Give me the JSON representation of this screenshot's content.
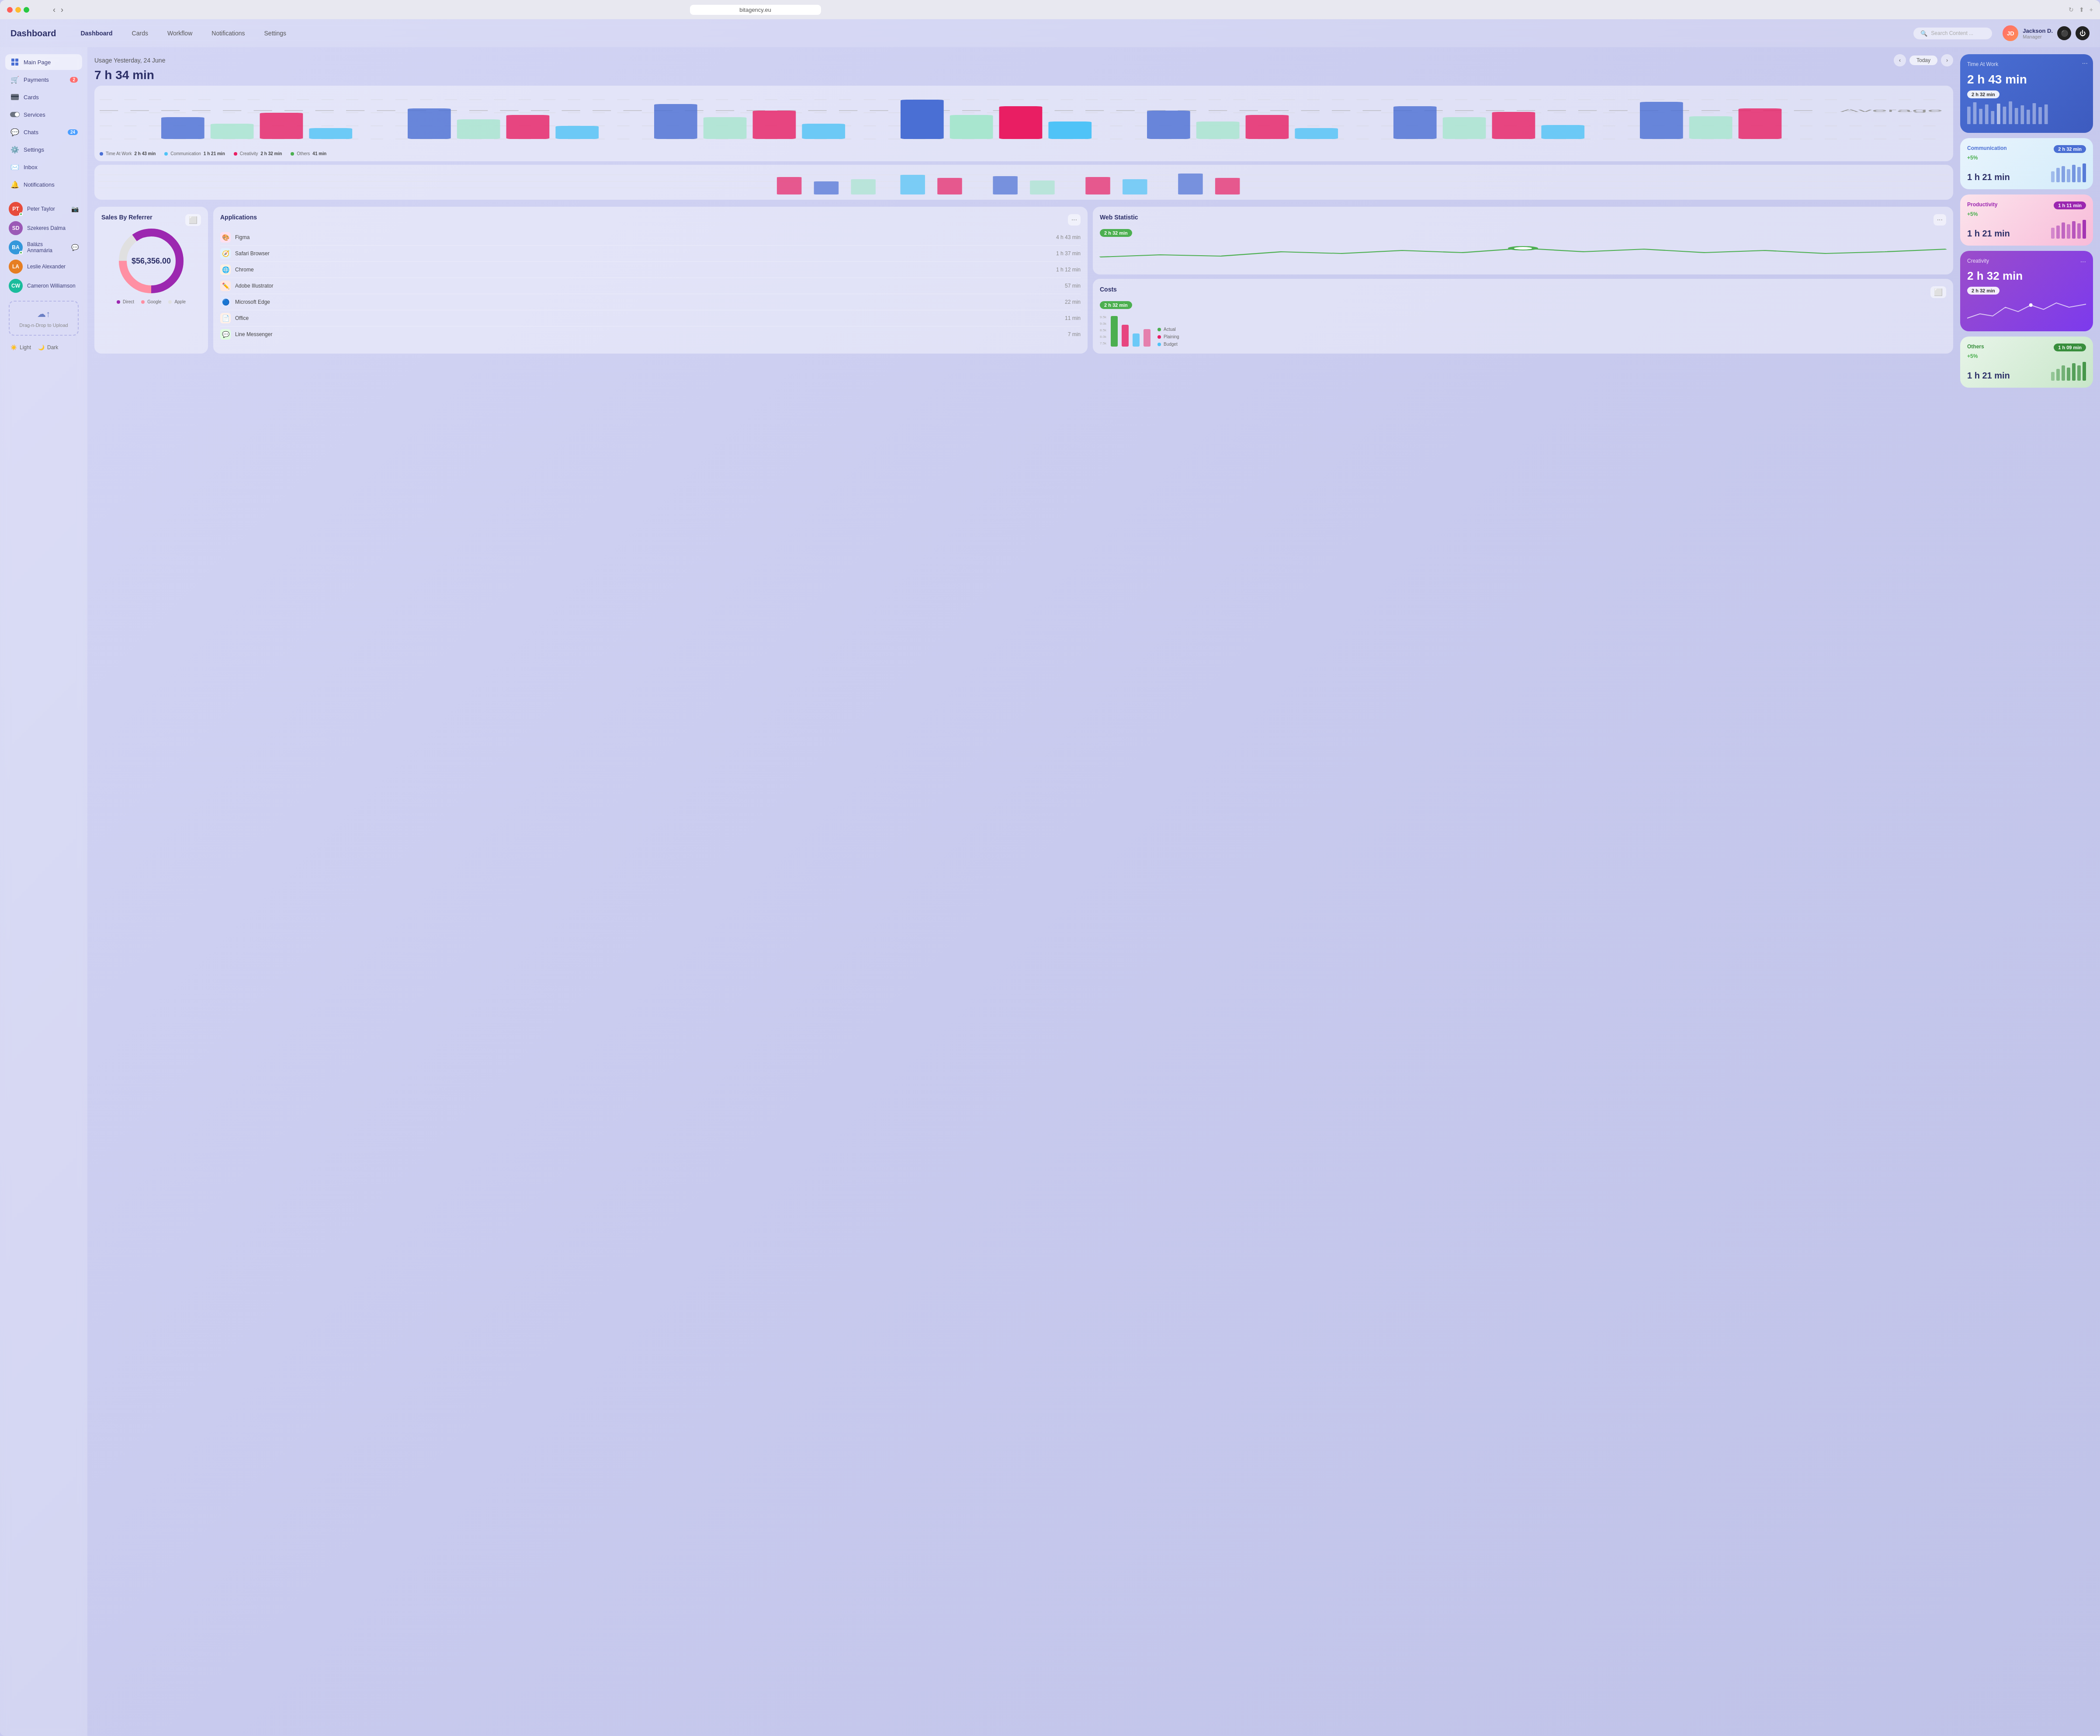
{
  "browser": {
    "url": "bitagency.eu"
  },
  "app": {
    "title": "Dashboard"
  },
  "topnav": {
    "links": [
      {
        "label": "Dashboard",
        "active": true
      },
      {
        "label": "Cards",
        "active": false
      },
      {
        "label": "Workflow",
        "active": false
      },
      {
        "label": "Notifications",
        "active": false
      },
      {
        "label": "Settings",
        "active": false
      }
    ],
    "search_placeholder": "Search Content ...",
    "user": {
      "name": "Jackson D.",
      "role": "Manager",
      "initials": "JD"
    }
  },
  "sidebar": {
    "items": [
      {
        "label": "Main Page",
        "icon": "grid",
        "active": true
      },
      {
        "label": "Payments",
        "icon": "cart",
        "badge": "2"
      },
      {
        "label": "Cards",
        "icon": "card"
      },
      {
        "label": "Services",
        "icon": "toggle"
      },
      {
        "label": "Chats",
        "icon": "chat",
        "badge": "24"
      },
      {
        "label": "Settings",
        "icon": "settings"
      },
      {
        "label": "Inbox",
        "icon": "mail"
      },
      {
        "label": "Notifications",
        "icon": "bell"
      }
    ],
    "contacts": [
      {
        "name": "Peter Taylor",
        "initials": "PT",
        "color": "#e74c3c",
        "online": true
      },
      {
        "name": "Szekeres Dalma",
        "initials": "SD",
        "color": "#9b59b6",
        "online": false
      },
      {
        "name": "Balázs Annamária",
        "initials": "BA",
        "color": "#3498db",
        "online": true
      },
      {
        "name": "Leslie Alexander",
        "initials": "LA",
        "color": "#e67e22",
        "online": false
      },
      {
        "name": "Cameron Williamson",
        "initials": "CW",
        "color": "#1abc9c",
        "online": false
      }
    ],
    "drag_upload": "Drag-n-Drop to Upload",
    "theme_light": "Light",
    "theme_dark": "Dark"
  },
  "usage": {
    "title": "Usage Yesterday, 24 June",
    "time": "7 h 34 min",
    "today_btn": "Today"
  },
  "stats_cards": [
    {
      "title": "Time At Work",
      "value": "2 h 43 min",
      "badge": "2 h 32 min",
      "type": "blue"
    },
    {
      "title": "Communication",
      "value": "1 h 21 min",
      "badge": "2 h 32 min",
      "sub": "+5%",
      "type": "light-blue"
    },
    {
      "title": "Productivity",
      "value": "1 h 21 min",
      "badge": "1 h 11 min",
      "sub": "+5%",
      "type": "light-pink"
    },
    {
      "title": "Others",
      "value": "1 h 21 min",
      "badge": "1 h 09 min",
      "sub": "+5%",
      "type": "light-green"
    },
    {
      "title": "Creativity",
      "value": "2 h 32 min",
      "badge": "2 h 32 min",
      "type": "purple"
    }
  ],
  "legend": [
    {
      "label": "Time At Work",
      "color": "#4a6fd4",
      "time": "2 h 43 min"
    },
    {
      "label": "Communication",
      "color": "#4fc3f7",
      "time": "1 h 21 min"
    },
    {
      "label": "Creativity",
      "color": "#e91e63",
      "time": "2 h 32 min"
    },
    {
      "label": "Others",
      "color": "#4caf50",
      "time": "41 min"
    }
  ],
  "sales": {
    "title": "Sales By Referrer",
    "total": "$56,356.00",
    "legend": [
      {
        "label": "Direct",
        "color": "#9c27b0"
      },
      {
        "label": "Google",
        "color": "#ff8fa3"
      },
      {
        "label": "Apple",
        "color": "#e0e0e0"
      }
    ]
  },
  "applications": {
    "title": "Applications",
    "items": [
      {
        "name": "Figma",
        "time": "4 h 43 min",
        "icon": "🎨"
      },
      {
        "name": "Safari Browser",
        "time": "1 h 37 min",
        "icon": "🧭"
      },
      {
        "name": "Chrome",
        "time": "1 h 12 min",
        "icon": "🌐"
      },
      {
        "name": "Adobe Illustrator",
        "time": "57 min",
        "icon": "✏️"
      },
      {
        "name": "Microsoft Edge",
        "time": "22 min",
        "icon": "🔵"
      },
      {
        "name": "Office",
        "time": "11 min",
        "icon": "📄"
      },
      {
        "name": "Line Messenger",
        "time": "7 min",
        "icon": "💬"
      }
    ]
  },
  "web_statistic": {
    "title": "Web Statistic",
    "badge": "2 h 32 min"
  },
  "costs": {
    "title": "Costs",
    "badge": "2 h 32 min",
    "legend": [
      {
        "label": "Actual",
        "color": "#4caf50"
      },
      {
        "label": "Plaining",
        "color": "#e91e63"
      },
      {
        "label": "Budget",
        "color": "#4fc3f7"
      }
    ]
  }
}
